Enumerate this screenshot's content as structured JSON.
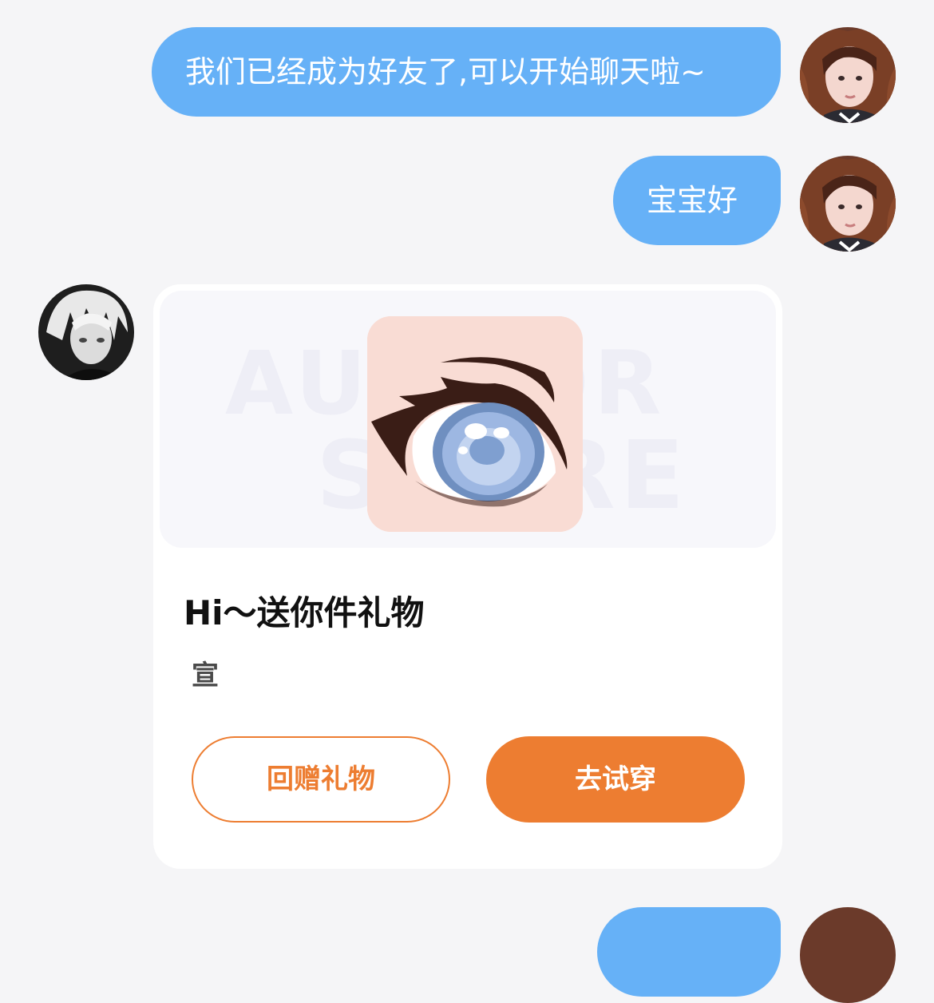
{
  "messages": [
    {
      "side": "outgoing",
      "text": "我们已经成为好友了,可以开始聊天啦~"
    },
    {
      "side": "outgoing",
      "text": "宝宝好"
    }
  ],
  "gift_card": {
    "watermark_line1": "AUTHOR",
    "watermark_line2": "STORE",
    "title": "Hi～送你件礼物",
    "subtitle": "宣",
    "return_gift_label": "回赠礼物",
    "try_on_label": "去试穿"
  },
  "colors": {
    "background": "#f5f5f7",
    "outgoing_bubble": "#66b1f7",
    "accent_orange": "#ed7d31",
    "card": "#ffffff"
  },
  "icons": {
    "self_avatar": "girl-photo-avatar",
    "contact_avatar": "anime-boy-avatar",
    "gift_item": "anime-eye-gift"
  }
}
